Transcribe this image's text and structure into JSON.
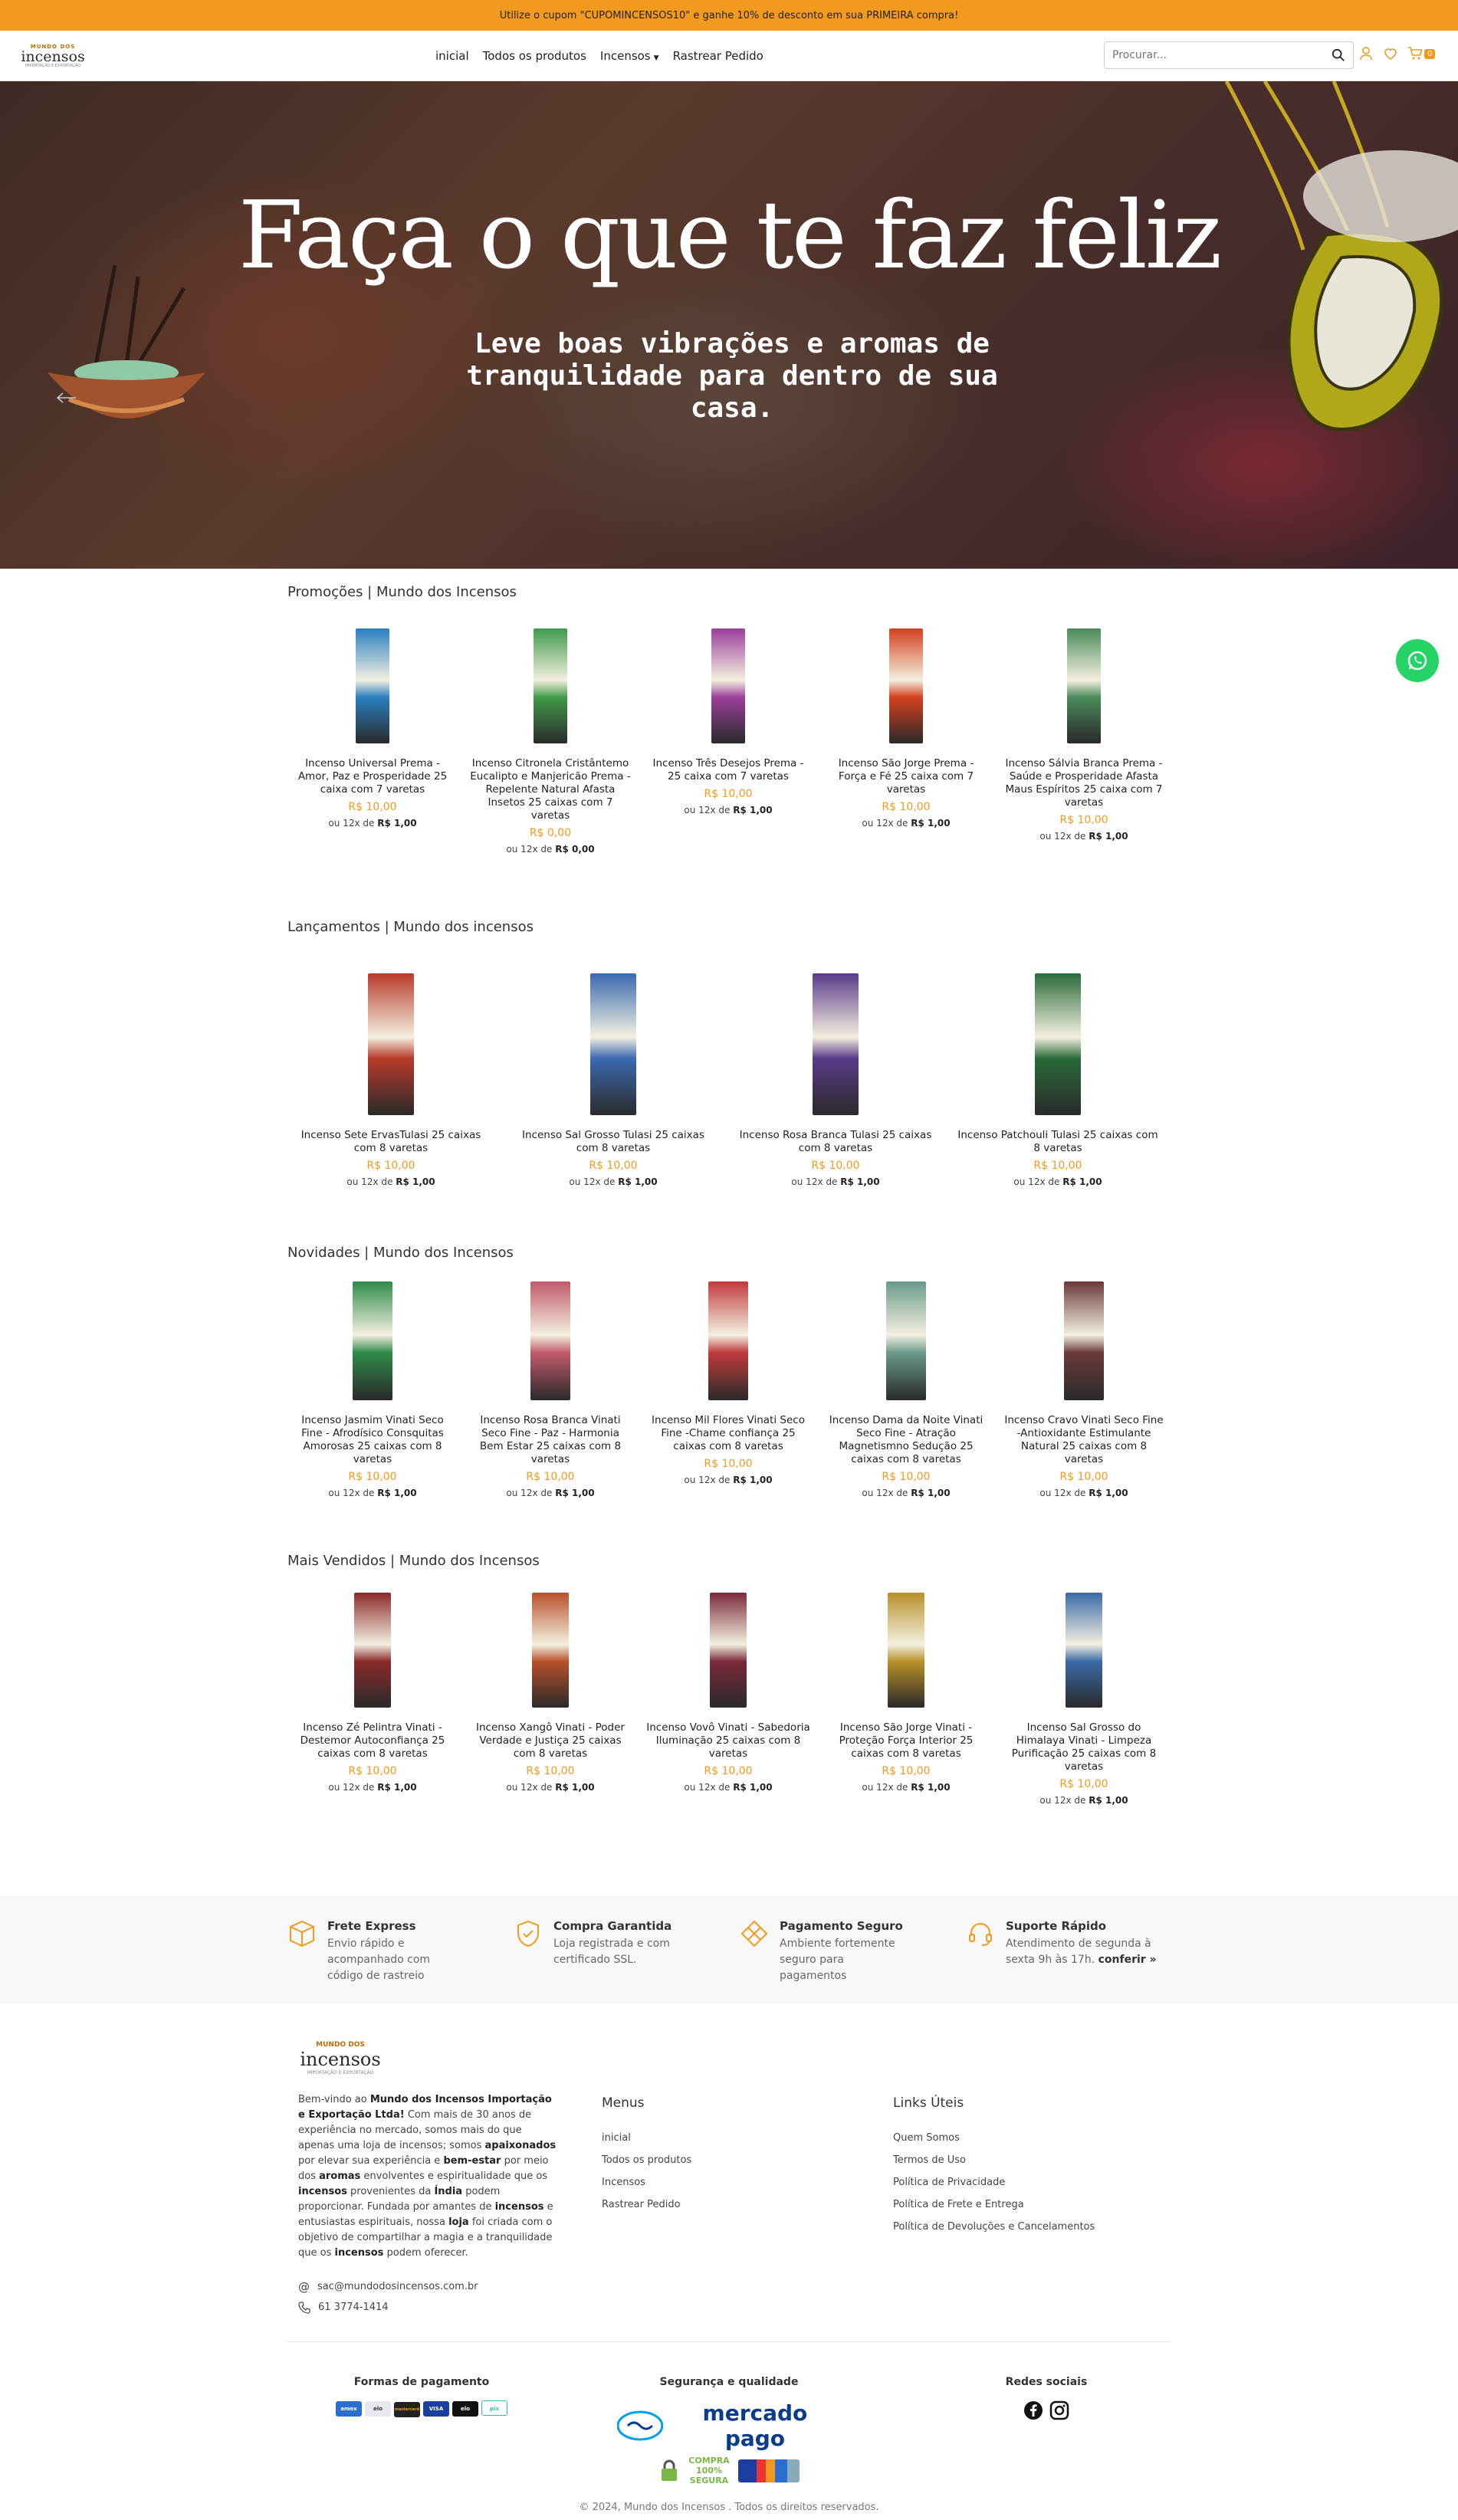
{
  "promo_bar": {
    "text": "Utilize o cupom \"CUPOMINCENSOS10\" e ganhe 10% de desconto em sua PRIMEIRA compra!"
  },
  "header": {
    "logo": {
      "top": "MUNDO DOS",
      "main": "incensos",
      "sub": "IMPORTAÇÃO E EXPORTAÇÃO"
    },
    "nav": [
      "inicial",
      "Todos os produtos",
      "Incensos",
      "Rastrear Pedido"
    ],
    "search_placeholder": "Procurar...",
    "cart_count": "0"
  },
  "hero": {
    "title": "Faça o que te faz feliz",
    "subtitle": "Leve boas vibrações e aromas de tranquilidade para dentro de sua casa."
  },
  "sections": [
    {
      "title": "Promoções | Mundo dos Incensos",
      "products": [
        {
          "name": "Incenso Universal Prema - Amor, Paz e Prosperidade 25 caixa com 7 varetas",
          "price": "R$ 10,00",
          "inst_prefix": "ou 12x de",
          "inst": "R$ 1,00",
          "color": "#2a7fc0"
        },
        {
          "name": "Incenso Citronela Cristântemo Eucalipto e Manjericão Prema - Repelente Natural Afasta Insetos 25 caixas com 7 varetas",
          "price": "R$ 0,00",
          "inst_prefix": "ou 12x de",
          "inst": "R$ 0,00",
          "color": "#3f9a4a"
        },
        {
          "name": "Incenso Três Desejos Prema - 25 caixa com 7 varetas",
          "price": "R$ 10,00",
          "inst_prefix": "ou 12x de",
          "inst": "R$ 1,00",
          "color": "#9a3f9a"
        },
        {
          "name": "Incenso São Jorge Prema - Força e Fé 25 caixa com 7 varetas",
          "price": "R$ 10,00",
          "inst_prefix": "ou 12x de",
          "inst": "R$ 1,00",
          "color": "#d4401e"
        },
        {
          "name": "Incenso Sálvia Branca Prema - Saúde e Prosperidade Afasta Maus Espíritos 25 caixa com 7 varetas",
          "price": "R$ 10,00",
          "inst_prefix": "ou 12x de",
          "inst": "R$ 1,00",
          "color": "#4a8a5a"
        }
      ]
    },
    {
      "title": "Lançamentos | Mundo dos incensos",
      "products": [
        {
          "name": "Incenso Sete ErvasTulasi 25 caixas com 8 varetas",
          "price": "R$ 10,00",
          "inst_prefix": "ou 12x de",
          "inst": "R$ 1,00",
          "color": "#b83a2a"
        },
        {
          "name": "Incenso Sal Grosso Tulasi 25 caixas com 8 varetas",
          "price": "R$ 10,00",
          "inst_prefix": "ou 12x de",
          "inst": "R$ 1,00",
          "color": "#3a6ab0"
        },
        {
          "name": "Incenso Rosa Branca Tulasi 25 caixas com 8 varetas",
          "price": "R$ 10,00",
          "inst_prefix": "ou 12x de",
          "inst": "R$ 1,00",
          "color": "#5a3a8a"
        },
        {
          "name": "Incenso Patchouli Tulasi 25 caixas com 8 varetas",
          "price": "R$ 10,00",
          "inst_prefix": "ou 12x de",
          "inst": "R$ 1,00",
          "color": "#2a6a3a"
        }
      ]
    },
    {
      "title": "Novidades | Mundo dos Incensos",
      "products": [
        {
          "name": "Incenso Jasmim Vinati Seco Fine - Afrodísico Consquitas Amorosas 25 caixas com 8 varetas",
          "price": "R$ 10,00",
          "inst_prefix": "ou 12x de",
          "inst": "R$ 1,00",
          "color": "#2f8a4a"
        },
        {
          "name": "Incenso Rosa Branca Vinati Seco Fine - Paz - Harmonia Bem Estar 25 caixas com 8 varetas",
          "price": "R$ 10,00",
          "inst_prefix": "ou 12x de",
          "inst": "R$ 1,00",
          "color": "#c05a6a"
        },
        {
          "name": "Incenso Mil Flores Vinati Seco Fine -Chame confiança 25 caixas com 8 varetas",
          "price": "R$ 10,00",
          "inst_prefix": "ou 12x de",
          "inst": "R$ 1,00",
          "color": "#c03a3a"
        },
        {
          "name": "Incenso Dama da Noite Vinati Seco Fine - Atração Magnetismno Sedução 25 caixas com 8 varetas",
          "price": "R$ 10,00",
          "inst_prefix": "ou 12x de",
          "inst": "R$ 1,00",
          "color": "#6a9a8a"
        },
        {
          "name": "Incenso Cravo Vinati Seco Fine -Antioxidante Estimulante Natural 25 caixas com 8 varetas",
          "price": "R$ 10,00",
          "inst_prefix": "ou 12x de",
          "inst": "R$ 1,00",
          "color": "#6a3a3a"
        }
      ]
    },
    {
      "title": "Mais Vendidos | Mundo dos Incensos",
      "products": [
        {
          "name": "Incenso Zé Pelintra Vinati - Destemor Autoconfiança 25 caixas com 8 varetas",
          "price": "R$ 10,00",
          "inst_prefix": "ou 12x de",
          "inst": "R$ 1,00",
          "color": "#8a2a2a"
        },
        {
          "name": "Incenso Xangô Vinati - Poder Verdade e Justiça 25 caixas com 8 varetas",
          "price": "R$ 10,00",
          "inst_prefix": "ou 12x de",
          "inst": "R$ 1,00",
          "color": "#b8502a"
        },
        {
          "name": "Incenso Vovô Vinati - Sabedoria Iluminação 25 caixas com 8 varetas",
          "price": "R$ 10,00",
          "inst_prefix": "ou 12x de",
          "inst": "R$ 1,00",
          "color": "#7a2a3a"
        },
        {
          "name": "Incenso São Jorge Vinati - Proteção Força Interior 25 caixas com 8 varetas",
          "price": "R$ 10,00",
          "inst_prefix": "ou 12x de",
          "inst": "R$ 1,00",
          "color": "#b8902a"
        },
        {
          "name": "Incenso Sal Grosso do Himalaya Vinati - Limpeza Purificação 25 caixas com 8 varetas",
          "price": "R$ 10,00",
          "inst_prefix": "ou 12x de",
          "inst": "R$ 1,00",
          "color": "#3a6aa8"
        }
      ]
    }
  ],
  "features": [
    {
      "title": "Frete Express",
      "desc": "Envio rápido e acompanhado com código de rastreio",
      "icon": "box-icon"
    },
    {
      "title": "Compra Garantida",
      "desc": "Loja registrada e com certificado SSL.",
      "icon": "shield-check-icon"
    },
    {
      "title": "Pagamento Seguro",
      "desc": "Ambiente fortemente seguro para pagamentos",
      "icon": "diamond-icon"
    },
    {
      "title": "Suporte Rápido",
      "desc": "Atendimento de segunda à sexta 9h às 17h.",
      "link": "conferir »",
      "icon": "headset-icon"
    }
  ],
  "footer": {
    "about_parts": [
      "Bem-vindo ao ",
      "Mundo dos Incensos Importação e Exportação Ltda!",
      " Com mais de 30 anos de experiência no mercado, somos mais do que apenas uma loja de incensos; somos ",
      "apaixonados",
      " por elevar sua experiência e ",
      "bem-estar",
      " por meio dos ",
      "aromas",
      " envolventes e espiritualidade que os ",
      "incensos",
      " provenientes da ",
      "Índia",
      " podem proporcionar. Fundada por amantes de ",
      "incensos",
      " e entusiastas espirituais, nossa ",
      "loja",
      " foi criada com o objetivo de compartilhar a magia e a tranquilidade que os ",
      "incensos",
      " podem oferecer."
    ],
    "email": "sac@mundodosincensos.com.br",
    "phone": "61 3774-1414",
    "menus_title": "Menus",
    "menus": [
      "inicial",
      "Todos os produtos",
      "Incensos",
      "Rastrear Pedido"
    ],
    "links_title": "Links Úteis",
    "links": [
      "Quem Somos",
      "Termos de Uso",
      "Política de Privacidade",
      "Política de Frete e Entrega",
      "Política de Devoluções e Cancelamentos"
    ],
    "payments_title": "Formas de pagamento",
    "payments": [
      "amex",
      "elo",
      "mastercard",
      "VISA",
      "elo",
      "pix"
    ],
    "security_title": "Segurança e qualidade",
    "security_brand": "mercado pago",
    "security_badge": "COMPRA 100% SEGURA",
    "social_title": "Redes sociais",
    "copyright": "© 2024, Mundo dos Incensos . Todos os direitos reservados."
  },
  "colors": {
    "accent": "#f29a1e",
    "whatsapp": "#25d366"
  }
}
